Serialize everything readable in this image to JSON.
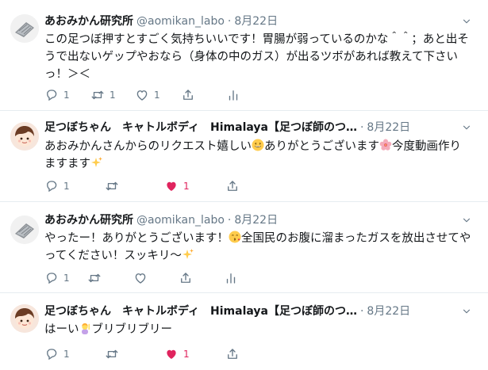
{
  "tweets": [
    {
      "name": "あおみかん研究所",
      "handle": "@aomikan_labo",
      "dot": "·",
      "date": "8月22日",
      "text1": "この足つぼ押すとすごく気持ちいいです！胃腸が弱っているのかな＾＾；あと出そうで出ないゲップやおなら（身体の中のガス）が出るツボがあれば教えて下さいっ！＞＜",
      "reply_count": "1",
      "retweet_count": "1",
      "like_count": "1",
      "liked": false
    },
    {
      "name": "足つぼちゃん　キャトルボディ　Himalaya【足つぼ師のつ…",
      "handle": "",
      "dot": "·",
      "date": "8月22日",
      "text1": "あおみかんさんからのリクエスト嬉しい",
      "text2": "ありがとうございます",
      "text3": "今度動画作りますます",
      "reply_count": "1",
      "retweet_count": "",
      "like_count": "1",
      "liked": true
    },
    {
      "name": "あおみかん研究所",
      "handle": "@aomikan_labo",
      "dot": "·",
      "date": "8月22日",
      "text1": "やったー！ありがとうございます！",
      "text2": "全国民のお腹に溜まったガスを放出させてやってください！スッキリ～",
      "reply_count": "1",
      "retweet_count": "",
      "like_count": "",
      "liked": false
    },
    {
      "name": "足つぼちゃん　キャトルボディ　Himalaya【足つぼ師のつ…",
      "handle": "",
      "dot": "·",
      "date": "8月22日",
      "text1": "はーい",
      "text2": "ブリブリブリー",
      "reply_count": "1",
      "retweet_count": "",
      "like_count": "1",
      "liked": true
    }
  ],
  "icons": {
    "reply": "reply-icon",
    "retweet": "retweet-icon",
    "like": "heart-icon",
    "share": "share-icon",
    "analytics": "analytics-icon",
    "caret": "chevron-down-icon"
  },
  "colors": {
    "name": "#14171a",
    "muted": "#657786",
    "like": "#e0245e",
    "divider": "#e6ecf0"
  }
}
